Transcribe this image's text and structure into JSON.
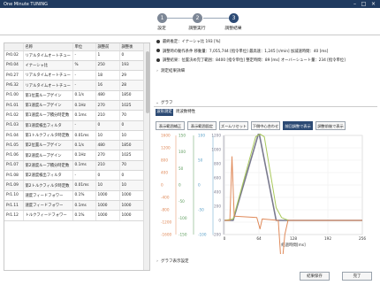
{
  "app": {
    "title": "One Minute TUNING"
  },
  "steps": [
    {
      "num": "1",
      "label": "設定",
      "state": "done"
    },
    {
      "num": "2",
      "label": "調整実行",
      "state": "done"
    },
    {
      "num": "3",
      "label": "調整結果",
      "state": "active"
    }
  ],
  "table": {
    "columns": [
      "",
      "名称",
      "単位",
      "調整前",
      "調整後"
    ],
    "rows": [
      [
        "Pr0.02",
        "リアルタイムオートチュー",
        "-",
        "1",
        "0"
      ],
      [
        "Pr0.04",
        "イナーシャ比",
        "%",
        "250",
        "193"
      ],
      [
        "Pr0.27",
        "リアルタイムオートチュー",
        "-",
        "18",
        "29"
      ],
      [
        "Pr6.32",
        "リアルタイムオートチュー",
        "-",
        "16",
        "28"
      ],
      [
        "Pr1.00",
        "第1位置ループゲイン",
        "0.1/s",
        "480",
        "1850"
      ],
      [
        "Pr1.01",
        "第1速度ループゲイン",
        "0.1Hz",
        "270",
        "1025"
      ],
      [
        "Pr1.02",
        "第1速度ループ積分時定数",
        "0.1ms",
        "210",
        "70"
      ],
      [
        "Pr1.03",
        "第1速度検出フィルタ",
        "-",
        "0",
        "0"
      ],
      [
        "Pr1.04",
        "第1トルクフィルタ時定数",
        "0.01ms",
        "10",
        "10"
      ],
      [
        "Pr1.05",
        "第2位置ループゲイン",
        "0.1/s",
        "480",
        "1850"
      ],
      [
        "Pr1.06",
        "第2速度ループゲイン",
        "0.1Hz",
        "270",
        "1025"
      ],
      [
        "Pr1.07",
        "第2速度ループ積分時定数",
        "0.1ms",
        "210",
        "70"
      ],
      [
        "Pr1.08",
        "第2速度検出フィルタ",
        "-",
        "0",
        "0"
      ],
      [
        "Pr1.09",
        "第2トルクフィルタ時定数",
        "0.01ms",
        "10",
        "10"
      ],
      [
        "Pr1.10",
        "速度フィードフォワー",
        "0.1%",
        "1000",
        "1000"
      ],
      [
        "Pr1.11",
        "速度フィードフォワー",
        "0.1ms",
        "1000",
        "1000"
      ],
      [
        "Pr1.12",
        "トルクフィードフォワー",
        "0.1%",
        "1000",
        "1000"
      ]
    ]
  },
  "info_lines": [
    "最終推定：イナーシャ比 193 [%]",
    "調整時の動作条件 移動量：7,055,744 [指令単位] 最高速：1,245 [r/min] 加減速時間：40 [ms]",
    "調整結果：位置決め完了範囲：8400 [指令単位] 整定時間：89 [ms] オーバーシュート量：234 [指令単位]"
  ],
  "sections": {
    "detail": "測定結果詳細",
    "graph": "グラフ",
    "graph_settings": "グラフ表示設定"
  },
  "inner_tabs": [
    "波形測定",
    "周波数特性"
  ],
  "toolbar": [
    "表示範囲補正",
    "表示範囲固定",
    "ズームリセット",
    "下側中心合わせ",
    "前回調整で表示",
    "調整前後で表示"
  ],
  "chart_data": {
    "type": "line",
    "xlabel": "経過時間[ms]",
    "x_ticks": [
      0,
      64,
      128,
      192,
      256
    ],
    "xlim": [
      0,
      256
    ],
    "y_axes": [
      {
        "ticks": [
          1600,
          1200,
          800,
          400,
          0,
          -400,
          -800,
          -1200,
          -1600
        ],
        "color": "#e08a5a"
      },
      {
        "ticks": [
          150,
          100,
          50,
          0,
          -50,
          -100,
          -150
        ],
        "color": "#5a9a5a"
      },
      {
        "ticks": [
          100,
          50,
          0,
          -50,
          -100
        ],
        "color": "#5aa0c8"
      },
      {
        "ticks": [
          1200,
          1000,
          800,
          600,
          400,
          200,
          0,
          -200
        ],
        "color": "#7a7a8e"
      }
    ],
    "series": [
      {
        "color": "#7a7a8e",
        "x": [
          0,
          16,
          64,
          96,
          112,
          120,
          256
        ],
        "y": [
          0,
          0,
          1245,
          0,
          0,
          0,
          0
        ]
      },
      {
        "color": "#a8c85a",
        "x": [
          0,
          16,
          58,
          66,
          74,
          96,
          106,
          114,
          120,
          130,
          256
        ],
        "y": [
          0,
          20,
          1180,
          1220,
          1180,
          180,
          40,
          15,
          0,
          0,
          0
        ]
      },
      {
        "color": "#e08a5a",
        "x": [
          0,
          10,
          14,
          18,
          60,
          66,
          70,
          100,
          106,
          112,
          118,
          256
        ],
        "y": [
          0,
          0,
          900,
          60,
          40,
          -120,
          20,
          0,
          -700,
          -200,
          0,
          0
        ]
      }
    ]
  },
  "footer": {
    "save": "結果保存",
    "done": "完了"
  }
}
